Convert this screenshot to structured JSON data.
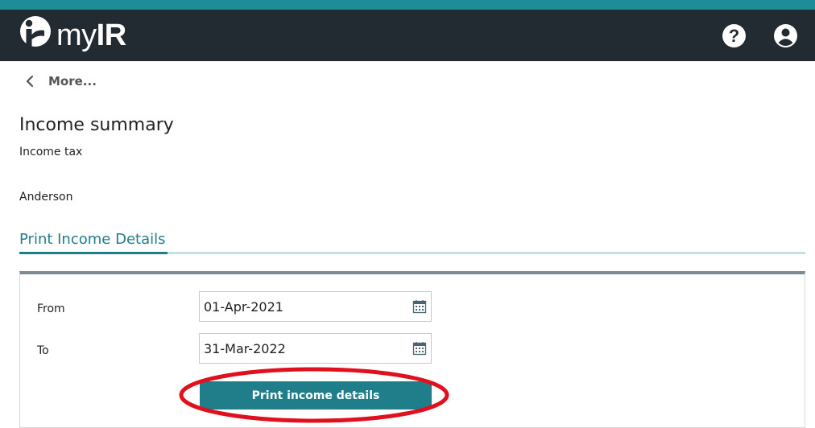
{
  "header": {
    "logo_my": "my",
    "logo_ir": "IR",
    "help_label": "?"
  },
  "nav": {
    "back_label": "More..."
  },
  "page": {
    "title": "Income summary",
    "subtitle": "Income tax",
    "name": "Anderson"
  },
  "tabs": [
    {
      "label": "Print Income Details",
      "active": true
    }
  ],
  "form": {
    "from_label": "From",
    "from_value": "01-Apr-2021",
    "to_label": "To",
    "to_value": "31-Mar-2022",
    "submit_label": "Print income details"
  },
  "colors": {
    "accent": "#1f8d98",
    "header_bg": "#212b31",
    "button": "#1f7e89",
    "highlight": "#e0101e"
  },
  "icons": {
    "logo": "myir-logo-icon",
    "help": "question-circle-icon",
    "account": "user-circle-icon",
    "back": "chevron-left-icon",
    "calendar": "calendar-icon"
  }
}
